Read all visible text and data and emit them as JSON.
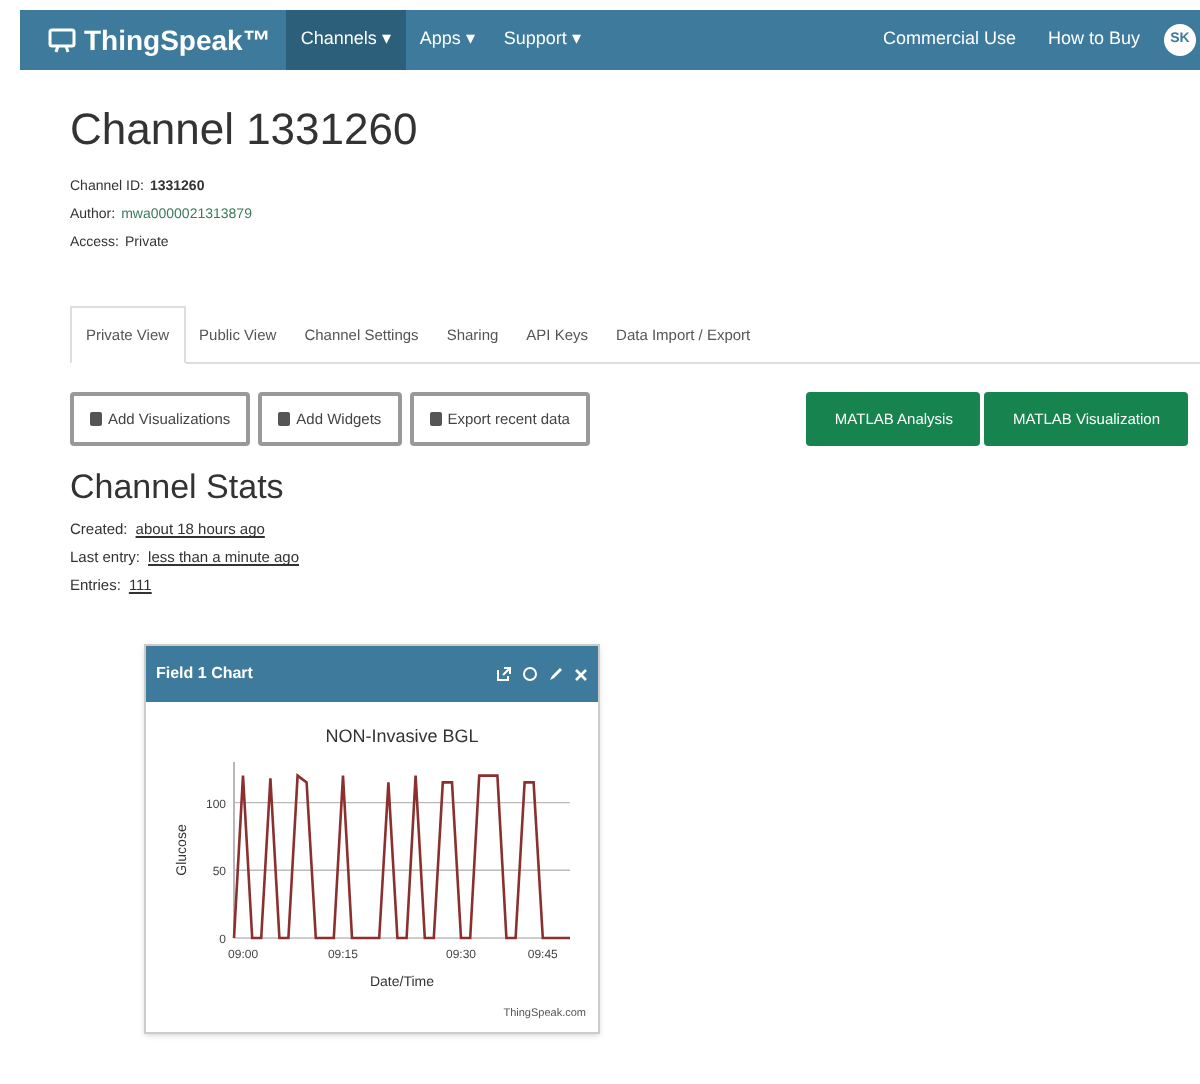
{
  "navbar": {
    "brand": "ThingSpeak™",
    "menus": [
      {
        "label": "Channels ▾",
        "selected": true
      },
      {
        "label": "Apps ▾",
        "selected": false
      },
      {
        "label": "Support ▾",
        "selected": false
      }
    ],
    "links": [
      "Commercial Use",
      "How to Buy"
    ],
    "avatar": "SK"
  },
  "channel": {
    "title": "Channel 1331260",
    "info": [
      {
        "label": "Channel ID:",
        "value": "1331260"
      },
      {
        "label": "Author:",
        "value": "mwa0000021313879"
      },
      {
        "label": "Access:",
        "value": "Private"
      }
    ]
  },
  "tabs": [
    {
      "label": "Private View",
      "selected": true
    },
    {
      "label": "Public View",
      "selected": false
    },
    {
      "label": "Channel Settings",
      "selected": false
    },
    {
      "label": "Sharing",
      "selected": false
    },
    {
      "label": "API Keys",
      "selected": false
    },
    {
      "label": "Data Import / Export",
      "selected": false
    }
  ],
  "actions": [
    "Add Visualizations",
    "Add Widgets",
    "Export recent data"
  ],
  "matlab_buttons": [
    "MATLAB Analysis",
    "MATLAB Visualization"
  ],
  "stats": {
    "title": "Channel Stats",
    "items": [
      {
        "label": "Created:",
        "value": "about 18 hours ago"
      },
      {
        "label": "Last entry:",
        "value": "less than a minute ago"
      },
      {
        "label": "Entries:",
        "value": "111"
      }
    ]
  },
  "chart_card": {
    "title": "Field 1 Chart",
    "chart_data": {
      "type": "line",
      "title": "NON-Invasive BGL",
      "xlabel": "Date/Time",
      "ylabel": "Glucose",
      "categories": [
        null,
        "09:00",
        null,
        null,
        null,
        null,
        null,
        null,
        null,
        null,
        null,
        null,
        "09:15",
        null,
        null,
        null,
        null,
        null,
        null,
        null,
        null,
        null,
        null,
        null,
        null,
        "09:30",
        null,
        null,
        null,
        null,
        null,
        null,
        null,
        null,
        "09:45",
        null,
        null,
        null
      ],
      "series": [
        {
          "color": "#8b2f2f",
          "values": [
            0,
            120,
            0,
            0,
            118,
            0,
            0,
            120,
            115,
            0,
            0,
            0,
            120,
            0,
            0,
            0,
            0,
            115,
            0,
            0,
            120,
            0,
            0,
            115,
            115,
            0,
            0,
            120,
            120,
            120,
            0,
            0,
            115,
            115,
            0,
            0,
            0,
            0
          ]
        }
      ],
      "ylim": [
        0,
        130
      ],
      "yticks": [
        0,
        50,
        100
      ]
    },
    "credit": "ThingSpeak.com"
  }
}
